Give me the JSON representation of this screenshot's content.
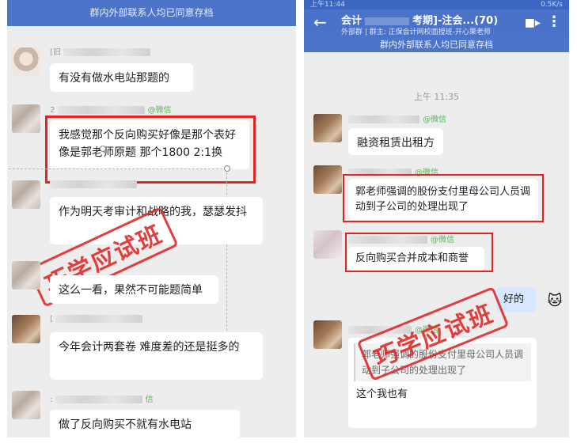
{
  "left": {
    "notice": "群内外部联系人均已同意存档",
    "messages": [
      {
        "sender_prefix": "[旧",
        "text": "有没有做水电站那题的"
      },
      {
        "sender_prefix": "2",
        "sender_suffix": "@微信",
        "text": "我感觉那个反向购买好像是那个表好像是郭老师原题 那个1800 2:1换"
      },
      {
        "sender_prefix": "",
        "text": "作为明天考审计和战略的我，瑟瑟发抖"
      },
      {
        "sender_prefix": "",
        "text": "这么一看，果然不可能题简单"
      },
      {
        "sender_prefix": "[",
        "text": "今年会计两套卷 难度差的还是挺多的"
      },
      {
        "sender_prefix": ":",
        "sender_suffix": "信",
        "text": "做了反向购买不就有水电站"
      }
    ],
    "stamp": "巧学应试班"
  },
  "right": {
    "status": "上午11:44",
    "status_right": "0.5K/s",
    "title": "会计",
    "title_suffix": "考期]-注会...(70)",
    "subtitle": "外部群 | 群主: 正保会计网校面授班-开心果老师",
    "notice": "群内外部联系人均已同意存档",
    "time": "上午 11:35",
    "messages": [
      {
        "sender_suffix": "@微信",
        "text": "融资租赁出租方"
      },
      {
        "sender_suffix": "@微信",
        "text": "郭老师强调的股份支付里母公司人员调动到子公司的处理出现了"
      },
      {
        "sender_suffix": "@微信",
        "text": "反向购买合并成本和商誉"
      },
      {
        "text": "好的"
      },
      {
        "sender_suffix": "@微信",
        "quote": "郭老师强调的股份支付里母公司人员调动到子公司的处理出现了",
        "text": "这个我也有"
      }
    ],
    "stamp": "巧学应试班",
    "icons": {
      "back": "arrow-left-icon",
      "video": "video-icon",
      "more": "more-vertical-icon",
      "sticker": "sticker-icon"
    }
  }
}
